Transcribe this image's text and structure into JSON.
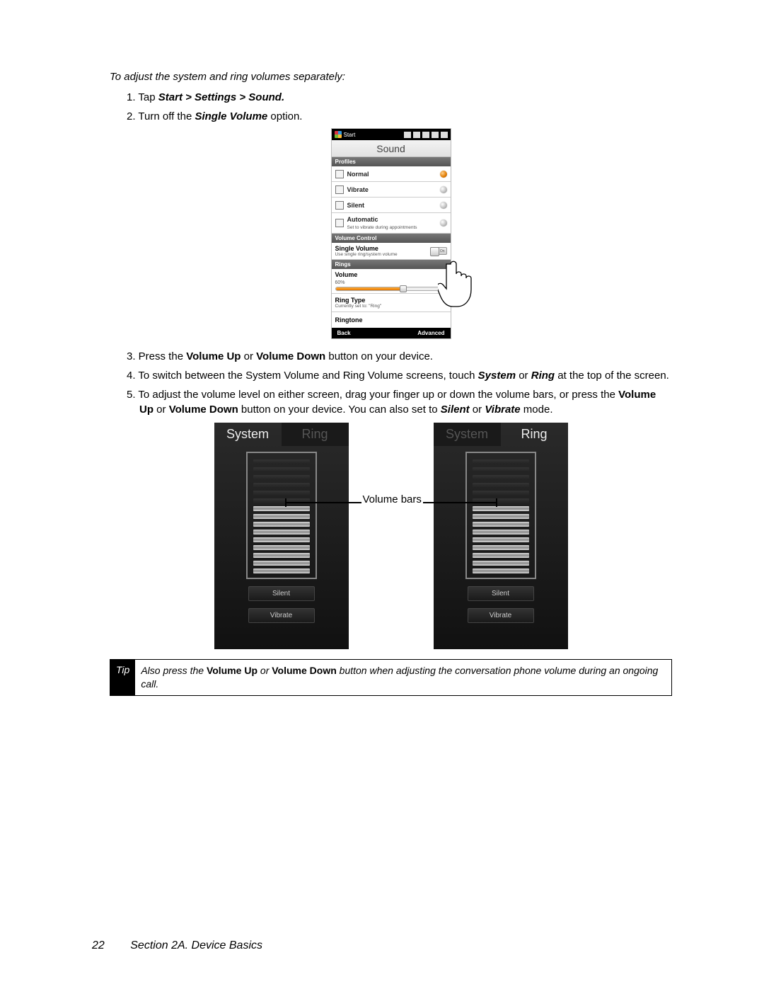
{
  "intro": "To adjust the system and ring volumes separately:",
  "steps12": {
    "s1_pre": "1. Tap ",
    "s1_bold": "Start > Settings > Sound.",
    "s2_pre": "2. Turn off the ",
    "s2_bold": "Single Volume",
    "s2_post": " option."
  },
  "phone": {
    "start": "Start",
    "title": "Sound",
    "profiles_hdr": "Profiles",
    "normal": "Normal",
    "vibrate": "Vibrate",
    "silent": "Silent",
    "automatic": "Automatic",
    "automatic_sub": "Set to vibrate during appointments",
    "volctrl_hdr": "Volume Control",
    "single_volume": "Single Volume",
    "single_volume_sub": "Use single ring/system volume",
    "toggle_text": "On",
    "rings_hdr": "Rings",
    "volume_lab": "Volume",
    "volume_pct": "60%",
    "ringtype": "Ring Type",
    "ringtype_sub": "Currently set to: \"Ring\"",
    "ringtone": "Ringtone",
    "soft_left": "Back",
    "soft_right": "Advanced"
  },
  "steps345": {
    "s3_pre": "3. Press the ",
    "s3_b1": "Volume Up",
    "s3_mid": " or ",
    "s3_b2": "Volume Down",
    "s3_post": " button on your device.",
    "s4_pre": "4. To switch between the System Volume and Ring Volume screens, touch ",
    "s4_b1": "System",
    "s4_mid": " or ",
    "s4_b2": "Ring",
    "s4_post": " at the top of the screen.",
    "s5_pre": "5. To adjust the volume level on either screen, drag your finger up or down the volume bars, or press the ",
    "s5_b1": "Volume Up",
    "s5_mid1": " or ",
    "s5_b2": "Volume Down",
    "s5_mid2": " button on your device. You can also set to ",
    "s5_b3": "Silent",
    "s5_mid3": " or ",
    "s5_b4": "Vibrate",
    "s5_post": " mode."
  },
  "volscreens": {
    "system": "System",
    "ring": "Ring",
    "silent_btn": "Silent",
    "vibrate_btn": "Vibrate",
    "label": "Volume bars"
  },
  "tip": {
    "label": "Tip",
    "t1": "Also press the ",
    "b1": "Volume Up",
    "t2": " or ",
    "b2": "Volume Down",
    "t3": " button when adjusting the conversation phone volume during an ongoing call."
  },
  "footer": {
    "page": "22",
    "section": "Section 2A. Device Basics"
  }
}
